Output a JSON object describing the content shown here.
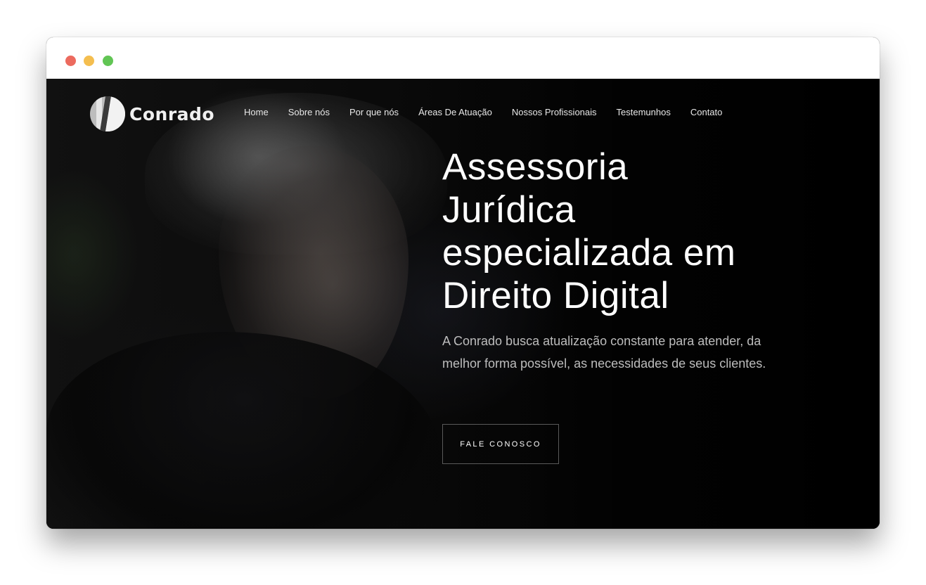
{
  "window": {
    "controls": [
      "close",
      "minimize",
      "maximize"
    ]
  },
  "nav": {
    "logo_text": "Conrado",
    "logo_icon": "conrado-logo-icon",
    "items": [
      {
        "label": "Home"
      },
      {
        "label": "Sobre nós"
      },
      {
        "label": "Por que nós"
      },
      {
        "label": "Áreas De Atuação"
      },
      {
        "label": "Nossos Profissionais"
      },
      {
        "label": "Testemunhos"
      },
      {
        "label": "Contato"
      }
    ]
  },
  "hero": {
    "title_lines": [
      "Assessoria",
      "Jurídica",
      "especializada em",
      "Direito Digital"
    ],
    "subtitle": "A Conrado busca atualização constante para atender, da melhor forma possível, as necessidades de seus clientes.",
    "cta_label": "FALE CONOSCO"
  },
  "colors": {
    "background": "#050505",
    "text_primary": "#ffffff",
    "text_secondary": "#bdbdbd",
    "close": "#ec6a5e",
    "minimize": "#f4be4f",
    "maximize": "#61c554"
  }
}
